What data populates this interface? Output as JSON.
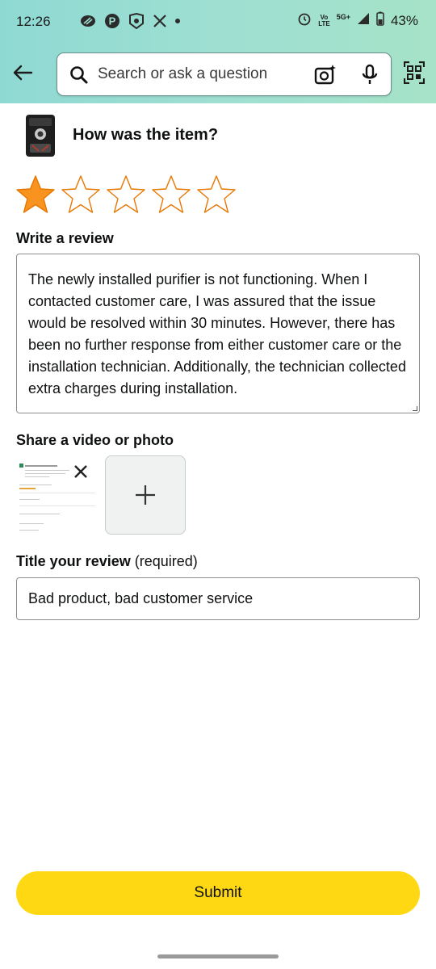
{
  "status_bar": {
    "time": "12:26",
    "volte_top": "Vo",
    "volte_bottom": "LTE",
    "network": "5G+",
    "battery": "43%",
    "icons": [
      "threads-icon",
      "pinterest-icon",
      "app-icon",
      "x-icon",
      "dot-icon",
      "alarm-icon",
      "signal-icon",
      "battery-icon"
    ]
  },
  "header": {
    "search_placeholder": "Search or ask a question",
    "background": "#9edfd2"
  },
  "product": {
    "question": "How was the item?"
  },
  "rating": {
    "value": 1,
    "max": 5,
    "filled_color": "#f7931e",
    "empty_color": "#e77600"
  },
  "review": {
    "heading": "Write a review",
    "text": "The newly installed purifier is not functioning. When I contacted customer care, I was assured that the issue would be resolved within 30 minutes. However, there has been no further response from either customer care or the installation technician. Additionally, the technician collected extra charges during installation."
  },
  "media": {
    "heading": "Share a video or photo"
  },
  "title_field": {
    "label": "Title your review",
    "label_note": "(required)",
    "value": "Bad product, bad customer service"
  },
  "submit": {
    "label": "Submit",
    "color": "#ffd814"
  }
}
